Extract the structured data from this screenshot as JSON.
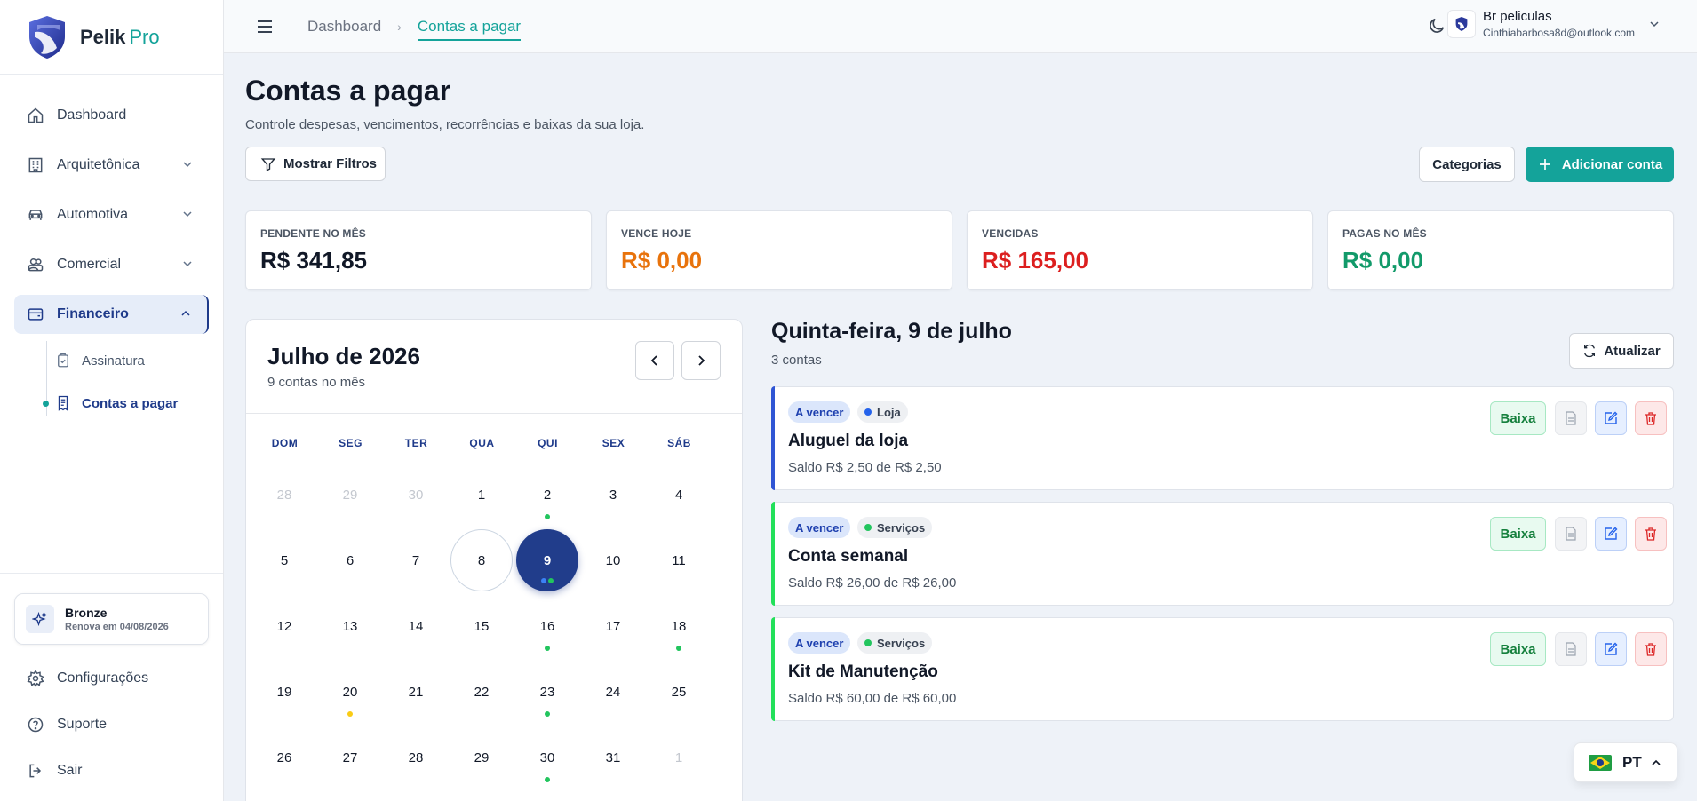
{
  "brand": {
    "name": "Pelik",
    "suffix": "Pro"
  },
  "sidebar": {
    "items": [
      {
        "label": "Dashboard",
        "icon": "home-icon"
      },
      {
        "label": "Arquitetônica",
        "icon": "building-icon",
        "expandable": true
      },
      {
        "label": "Automotiva",
        "icon": "car-icon",
        "expandable": true
      },
      {
        "label": "Comercial",
        "icon": "users-icon",
        "expandable": true
      },
      {
        "label": "Financeiro",
        "icon": "wallet-icon",
        "expanded": true,
        "active": true
      }
    ],
    "subitems": [
      {
        "label": "Assinatura",
        "icon": "clipboard-check-icon"
      },
      {
        "label": "Contas a pagar",
        "icon": "receipt-icon",
        "active": true
      }
    ],
    "plan": {
      "name": "Bronze",
      "renew": "Renova em 04/08/2026"
    },
    "bottom": [
      {
        "label": "Configurações",
        "icon": "gear-icon"
      },
      {
        "label": "Suporte",
        "icon": "help-icon"
      },
      {
        "label": "Sair",
        "icon": "logout-icon"
      }
    ]
  },
  "topbar": {
    "breadcrumb": [
      "Dashboard",
      "Contas a pagar"
    ],
    "user": {
      "name": "Br peliculas",
      "email": "Cinthiabarbosa8d@outlook.com"
    }
  },
  "page": {
    "title": "Contas a pagar",
    "subtitle": "Controle despesas, vencimentos, recorrências e baixas da sua loja.",
    "filter_button": "Mostrar Filtros",
    "categories_button": "Categorias",
    "add_button": "Adicionar conta"
  },
  "stats": [
    {
      "label": "PENDENTE NO MÊS",
      "value": "R$ 341,85",
      "color": "#111827"
    },
    {
      "label": "VENCE HOJE",
      "value": "R$ 0,00",
      "color": "#e8730c"
    },
    {
      "label": "VENCIDAS",
      "value": "R$ 165,00",
      "color": "#dc1f1f"
    },
    {
      "label": "PAGAS NO MÊS",
      "value": "R$ 0,00",
      "color": "#129a6a"
    }
  ],
  "calendar": {
    "month": "Julho de 2026",
    "count": "9 contas no mês",
    "weekdays": [
      "DOM",
      "SEG",
      "TER",
      "QUA",
      "QUI",
      "SEX",
      "SÁB"
    ],
    "weeks": [
      [
        {
          "d": "28",
          "m": true
        },
        {
          "d": "29",
          "m": true
        },
        {
          "d": "30",
          "m": true
        },
        {
          "d": "1"
        },
        {
          "d": "2",
          "dots": [
            "green"
          ]
        },
        {
          "d": "3"
        },
        {
          "d": "4"
        }
      ],
      [
        {
          "d": "5"
        },
        {
          "d": "6"
        },
        {
          "d": "7"
        },
        {
          "d": "8",
          "today": true
        },
        {
          "d": "9",
          "selected": true,
          "dots": [
            "blue",
            "green"
          ]
        },
        {
          "d": "10"
        },
        {
          "d": "11"
        }
      ],
      [
        {
          "d": "12"
        },
        {
          "d": "13"
        },
        {
          "d": "14"
        },
        {
          "d": "15"
        },
        {
          "d": "16",
          "dots": [
            "green"
          ]
        },
        {
          "d": "17"
        },
        {
          "d": "18",
          "dots": [
            "green"
          ]
        }
      ],
      [
        {
          "d": "19"
        },
        {
          "d": "20",
          "dots": [
            "yellow"
          ]
        },
        {
          "d": "21"
        },
        {
          "d": "22"
        },
        {
          "d": "23",
          "dots": [
            "green"
          ]
        },
        {
          "d": "24"
        },
        {
          "d": "25"
        }
      ],
      [
        {
          "d": "26"
        },
        {
          "d": "27"
        },
        {
          "d": "28"
        },
        {
          "d": "29"
        },
        {
          "d": "30",
          "dots": [
            "green"
          ]
        },
        {
          "d": "31"
        },
        {
          "d": "1",
          "m": true
        }
      ]
    ],
    "dot_colors": {
      "green": "#22c55e",
      "blue": "#3b82f6",
      "yellow": "#facc15"
    }
  },
  "day_panel": {
    "title": "Quinta-feira, 9 de julho",
    "count": "3 contas",
    "refresh_button": "Atualizar",
    "bills": [
      {
        "status": "A vencer",
        "category": "Loja",
        "category_color": "#2563eb",
        "bar_color": "#2f55d4",
        "name": "Aluguel da loja",
        "balance": "Saldo R$ 2,50 de R$ 2,50",
        "action": "Baixa"
      },
      {
        "status": "A vencer",
        "category": "Serviços",
        "category_color": "#22c55e",
        "bar_color": "#22e05a",
        "name": "Conta semanal",
        "balance": "Saldo R$ 26,00 de R$ 26,00",
        "action": "Baixa"
      },
      {
        "status": "A vencer",
        "category": "Serviços",
        "category_color": "#22c55e",
        "bar_color": "#22e05a",
        "name": "Kit de Manutenção",
        "balance": "Saldo R$ 60,00 de R$ 60,00",
        "action": "Baixa"
      }
    ]
  },
  "language": {
    "code": "PT",
    "flag": "brazil-flag-icon"
  }
}
